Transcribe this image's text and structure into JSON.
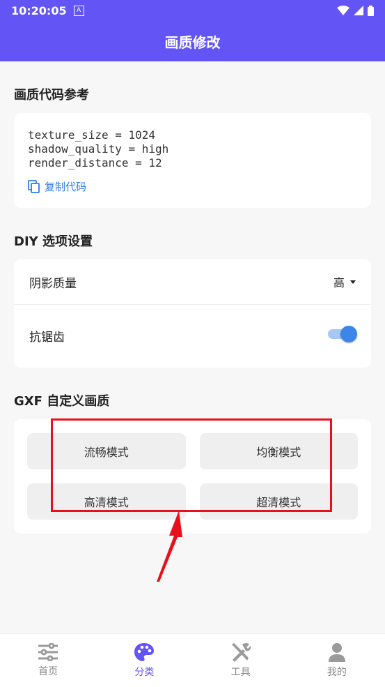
{
  "status_bar": {
    "time": "10:20:05",
    "notif_icon": "A"
  },
  "app_bar": {
    "title": "画质修改"
  },
  "code_section": {
    "title": "画质代码参考",
    "lines": [
      "texture_size = 1024",
      "shadow_quality = high",
      "render_distance = 12"
    ],
    "copy_label": "复制代码"
  },
  "diy_section": {
    "title": "DIY 选项设置",
    "shadow": {
      "label": "阴影质量",
      "value": "高"
    },
    "antialias": {
      "label": "抗锯齿",
      "on": true
    }
  },
  "gxf_section": {
    "title": "GXF 自定义画质",
    "modes": [
      "流畅模式",
      "均衡模式",
      "高清模式",
      "超清模式"
    ]
  },
  "bottom_nav": {
    "items": [
      {
        "label": "首页",
        "icon": "sliders-icon"
      },
      {
        "label": "分类",
        "icon": "palette-icon"
      },
      {
        "label": "工具",
        "icon": "tools-icon"
      },
      {
        "label": "我的",
        "icon": "person-icon"
      }
    ],
    "active": 1
  },
  "colors": {
    "primary": "#6355f5",
    "link": "#2b7de9",
    "annotation": "#e8101a"
  }
}
